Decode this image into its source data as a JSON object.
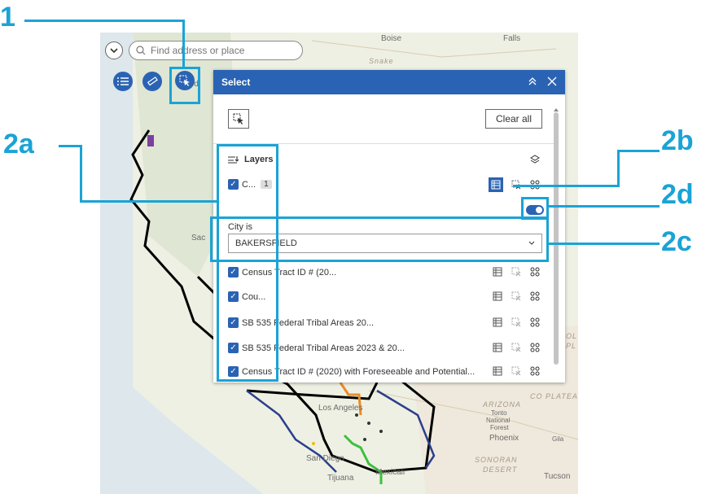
{
  "map": {
    "labels": {
      "boise": "Boise",
      "falls": "Falls",
      "snake": "Snake",
      "medford": "dford",
      "sac": "Sac",
      "los_angeles": "Los Angeles",
      "san_diego": "San Diego",
      "tijuana": "Tijuana",
      "mexicali": "Mexicali",
      "arizona": "ARIZONA",
      "tonto": "Tonto",
      "national": "National",
      "forest": "Forest",
      "phoenix": "Phoenix",
      "gila": "Gila",
      "sonoran": "SONORAN",
      "desert": "DESERT",
      "tucson": "Tucson",
      "colorado_plateau": "CO PLATEAU",
      "col_ol": "OL",
      "col_pl": "PL"
    }
  },
  "search": {
    "placeholder": "Find address or place"
  },
  "panel": {
    "title": "Select",
    "clear_all": "Clear all",
    "layers_heading": "Layers",
    "layer1": {
      "name": "C...",
      "count": "1"
    },
    "filter_label": "City is",
    "filter_value": "BAKERSFIELD",
    "layers": [
      {
        "name": "Census Tract ID # (20..."
      },
      {
        "name": "Cou..."
      },
      {
        "name": "SB 535 Federal Tribal Areas 20..."
      },
      {
        "name": "SB 535 Federal Tribal Areas 2023 & 20..."
      },
      {
        "name": "Census Tract ID # (2020) with Foreseeable and Potential..."
      }
    ]
  },
  "annotations": {
    "a1": "1",
    "a2a": "2a",
    "a2b": "2b",
    "a2c": "2c",
    "a2d": "2d"
  },
  "colors": {
    "accent": "#2a63b3",
    "annotation": "#1aa3d6"
  }
}
